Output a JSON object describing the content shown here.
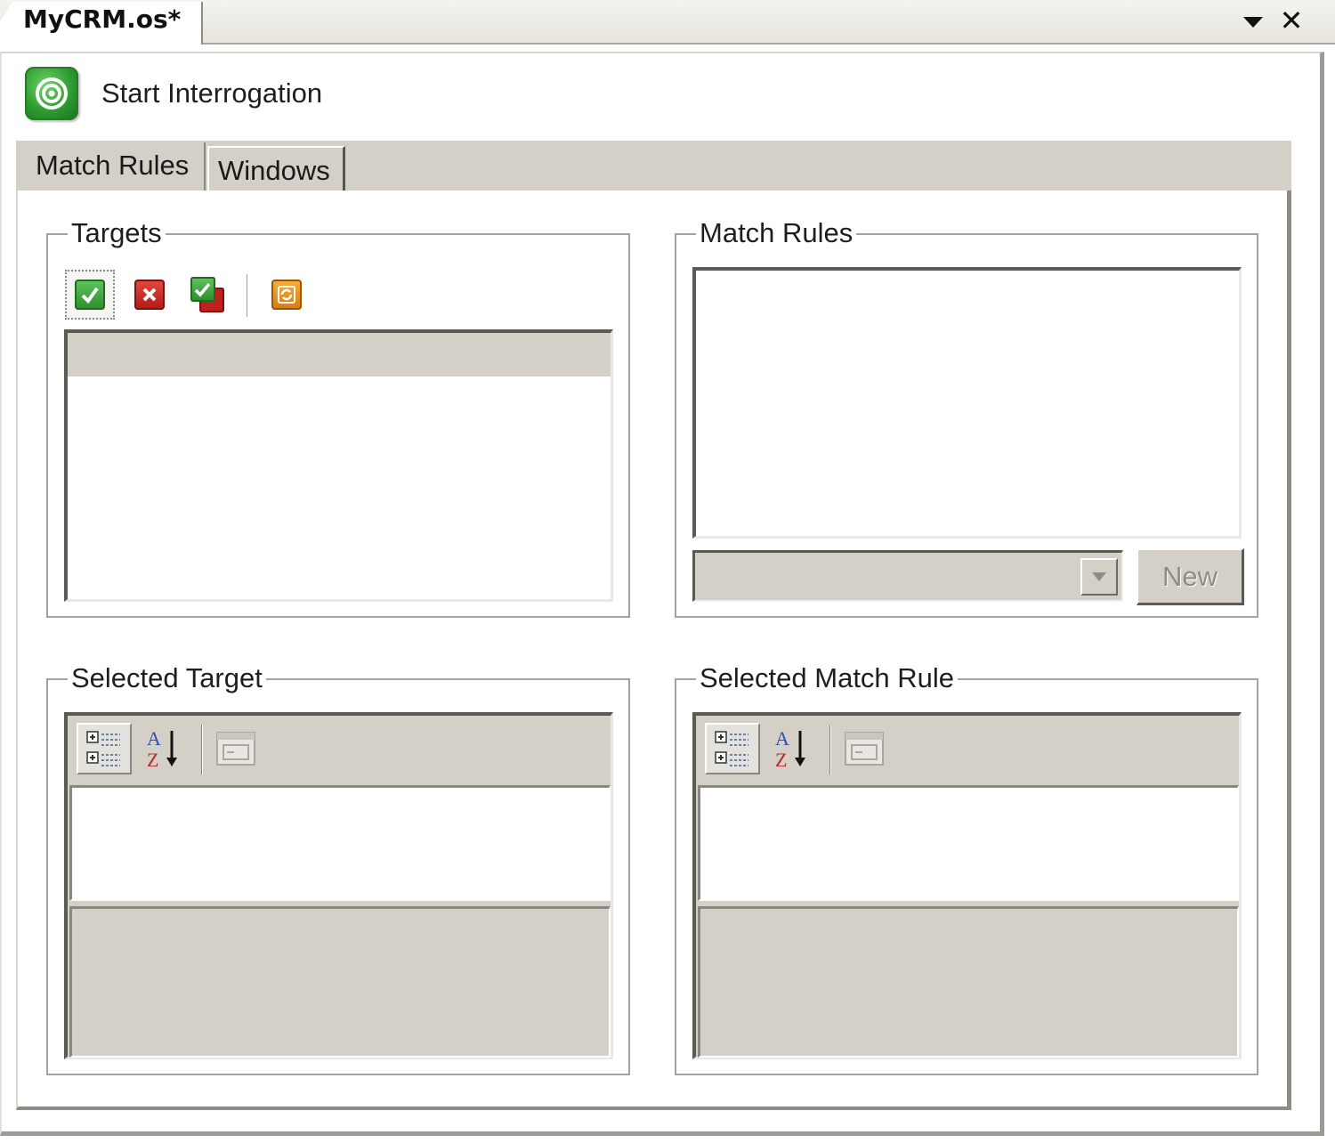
{
  "document_tab": {
    "title": "MyCRM.os*"
  },
  "window_controls": {
    "dropdown_icon": "chevron-down-icon",
    "close_glyph": "✕"
  },
  "toolbar": {
    "start_interrogation_label": "Start Interrogation",
    "start_icon": "target-icon"
  },
  "tabs": [
    {
      "label": "Match Rules",
      "selected": true
    },
    {
      "label": "Windows",
      "selected": false
    }
  ],
  "targets_group": {
    "title": "Targets",
    "toolbar_icons": [
      "check-icon",
      "delete-icon",
      "check-multiple-icon",
      "refresh-icon"
    ],
    "items": []
  },
  "match_rules_group": {
    "title": "Match Rules",
    "items": [],
    "combo_value": "",
    "new_button_label": "New"
  },
  "selected_target_group": {
    "title": "Selected Target",
    "toolbar_icons": [
      "categorized-icon",
      "alphabetical-sort-icon",
      "property-pages-icon"
    ]
  },
  "selected_match_rule_group": {
    "title": "Selected Match Rule",
    "toolbar_icons": [
      "categorized-icon",
      "alphabetical-sort-icon",
      "property-pages-icon"
    ]
  },
  "colors": {
    "control_face": "#d4d0c8",
    "accent_green": "#2d9a2e",
    "delete_red": "#c0201e",
    "refresh_orange": "#e08a12"
  }
}
